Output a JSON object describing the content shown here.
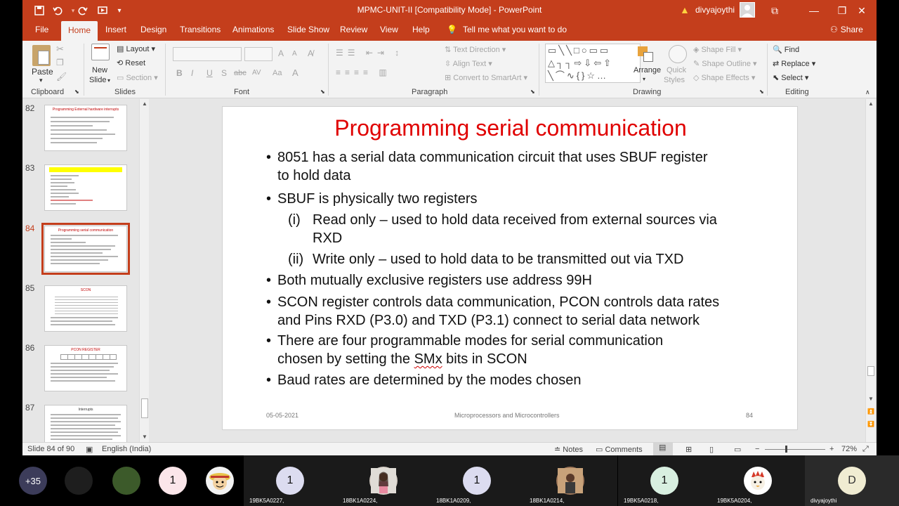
{
  "window": {
    "title": "MPMC-UNIT-II [Compatibility Mode]  -  PowerPoint",
    "user_name": "divyajoythi",
    "minimize_glyph": "—",
    "restore_glyph": "❐",
    "close_glyph": "✕",
    "ribbon_display_glyph": "⧉"
  },
  "qat": {
    "save_icon": "save-icon",
    "undo_icon": "undo-icon",
    "redo_icon": "redo-icon",
    "present_icon": "present-icon"
  },
  "tabs": [
    {
      "label": "File"
    },
    {
      "label": "Home"
    },
    {
      "label": "Insert"
    },
    {
      "label": "Design"
    },
    {
      "label": "Transitions"
    },
    {
      "label": "Animations"
    },
    {
      "label": "Slide Show"
    },
    {
      "label": "Review"
    },
    {
      "label": "View"
    },
    {
      "label": "Help"
    }
  ],
  "tell_me": "Tell me what you want to do",
  "share": "Share",
  "ribbon": {
    "clipboard": {
      "label": "Clipboard",
      "paste": "Paste"
    },
    "slides": {
      "label": "Slides",
      "new_slide_1": "New",
      "new_slide_2": "Slide",
      "layout": "Layout",
      "reset": "Reset",
      "section": "Section"
    },
    "font": {
      "label": "Font",
      "bold": "B",
      "italic": "I",
      "underline": "U",
      "strike": "S",
      "abc": "abc",
      "spacing": "AV",
      "case": "Aa",
      "grow": "A",
      "shrink": "A"
    },
    "paragraph": {
      "label": "Paragraph",
      "text_direction": "Text Direction",
      "align_text": "Align Text",
      "convert_smartart": "Convert to SmartArt"
    },
    "drawing": {
      "label": "Drawing",
      "arrange": "Arrange",
      "quick_styles_1": "Quick",
      "quick_styles_2": "Styles",
      "shape_fill": "Shape Fill",
      "shape_outline": "Shape Outline",
      "shape_effects": "Shape Effects",
      "shapes_glyphs_row1": "▭╲╲□○▭▭",
      "shapes_glyphs_row2": "△┐┐⇨⇩⇦⇧",
      "shapes_glyphs_row3": "╲⌒∿{}☆…"
    },
    "editing": {
      "label": "Editing",
      "find": "Find",
      "replace": "Replace",
      "select": "Select"
    }
  },
  "thumbnails": [
    {
      "number": "82",
      "title": "Programming External hardware interrupts"
    },
    {
      "number": "83",
      "title": ""
    },
    {
      "number": "84",
      "title": "Programming serial communication"
    },
    {
      "number": "85",
      "title": "SCON"
    },
    {
      "number": "86",
      "title": "PCON REGISTER"
    },
    {
      "number": "87",
      "title": "Interrupts"
    }
  ],
  "slide": {
    "title": "Programming serial communication",
    "bullet_char": "•",
    "lines": {
      "b1a": "8051 has a serial data communication circuit that uses SBUF register",
      "b1b": "to hold data",
      "b2": "SBUF is physically two registers",
      "s1_num": "(i)",
      "s1a": "Read only – used to hold data received from external sources via",
      "s1b": "RXD",
      "s2_num": "(ii)",
      "s2": "Write only – used to hold data to be transmitted out via TXD",
      "b3": "Both mutually exclusive registers use address 99H",
      "b4a": "SCON register controls data communication, PCON controls data rates",
      "b4b": "and Pins RXD (P3.0) and TXD (P3.1) connect to serial data network",
      "b5a": "There are four programmable modes for serial communication",
      "b5b_pre": "chosen by setting the ",
      "b5b_smx": "SMx",
      "b5b_post": " bits in SCON",
      "b6": "Baud rates are determined by the modes chosen"
    },
    "footer_date": "05-05-2021",
    "footer_center": "Microprocessors and Microcontrollers",
    "footer_page": "84"
  },
  "status": {
    "slide_of": "Slide 84 of 90",
    "language": "English (India)",
    "notes": "Notes",
    "comments": "Comments",
    "zoom": "72%",
    "zoom_minus": "−",
    "zoom_plus": "+"
  },
  "meeting": {
    "more_count": "+35",
    "participants": [
      {
        "name": "",
        "initial": "",
        "kind": "dark-avatar"
      },
      {
        "name": "",
        "initial": "",
        "kind": "photo-green"
      },
      {
        "name": "",
        "initial": "1",
        "kind": "pink"
      },
      {
        "name": "",
        "initial": "",
        "kind": "cartoon"
      },
      {
        "name": "19BK5A0227,",
        "initial": "1",
        "kind": "lavender"
      },
      {
        "name": "18BK1A0224,",
        "initial": "",
        "kind": "photo-person"
      },
      {
        "name": "18BK1A0209,",
        "initial": "1",
        "kind": "lavender"
      },
      {
        "name": "18BK1A0214,",
        "initial": "",
        "kind": "photo-person2"
      },
      {
        "name": "19BK5A0218,",
        "initial": "1",
        "kind": "mint"
      },
      {
        "name": "19BK5A0204,",
        "initial": "",
        "kind": "cartoon2"
      },
      {
        "name": "divyajoythi",
        "initial": "D",
        "kind": "cream"
      }
    ]
  },
  "colors": {
    "accent": "#c43e1c",
    "title_red": "#e00000"
  }
}
